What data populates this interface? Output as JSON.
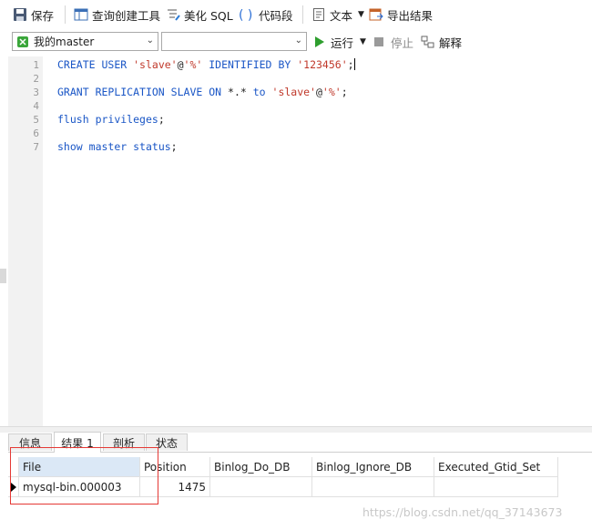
{
  "toolbar": {
    "save": "保存",
    "query_builder": "查询创建工具",
    "beautify_sql": "美化 SQL",
    "code_snippet": "代码段",
    "text": "文本",
    "export_results": "导出结果"
  },
  "toolbar2": {
    "connection": "我的master",
    "database": "",
    "run": "运行",
    "stop": "停止",
    "explain": "解释"
  },
  "editor": {
    "line_numbers": [
      "1",
      "2",
      "3",
      "4",
      "5",
      "6",
      "7"
    ],
    "lines": [
      "CREATE USER 'slave'@'%' IDENTIFIED BY '123456';",
      "",
      "GRANT REPLICATION SLAVE ON *.* to 'slave'@'%';",
      "",
      "flush privileges;",
      "",
      "show master status;"
    ]
  },
  "tabs": [
    "信息",
    "结果 1",
    "剖析",
    "状态"
  ],
  "results": {
    "columns": [
      "File",
      "Position",
      "Binlog_Do_DB",
      "Binlog_Ignore_DB",
      "Executed_Gtid_Set"
    ],
    "rows": [
      [
        "mysql-bin.000003",
        "1475",
        "",
        "",
        ""
      ]
    ]
  },
  "watermark": "https://blog.csdn.net/qq_37143673",
  "colors": {
    "keyword": "#1a56c6",
    "string": "#c0392b",
    "highlight_box": "#e53935",
    "run_green": "#2e9e2e"
  }
}
